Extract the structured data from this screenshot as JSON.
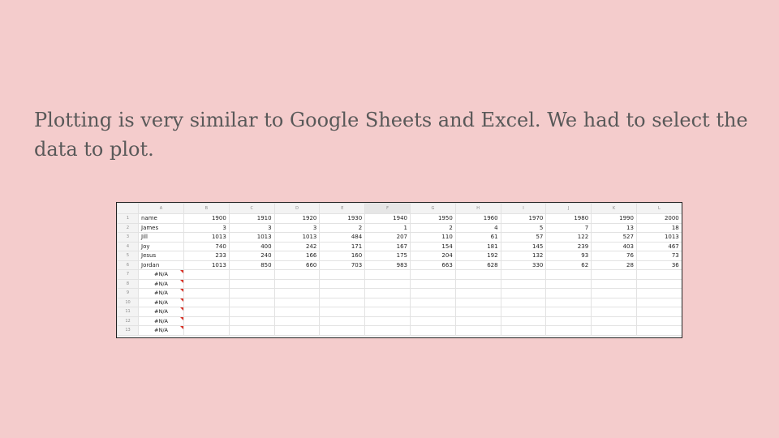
{
  "slide": {
    "text": "Plotting is very similar to Google Sheets and Excel. We had to select the data to plot."
  },
  "sheet": {
    "columns": [
      "A",
      "B",
      "C",
      "D",
      "E",
      "F",
      "G",
      "H",
      "I",
      "J",
      "K",
      "L"
    ],
    "selected_column": "F",
    "rows": [
      {
        "n": "1",
        "a": "name",
        "vals": [
          "1900",
          "1910",
          "1920",
          "1930",
          "1940",
          "1950",
          "1960",
          "1970",
          "1980",
          "1990",
          "2000"
        ]
      },
      {
        "n": "2",
        "a": "James",
        "vals": [
          "3",
          "3",
          "3",
          "2",
          "1",
          "2",
          "4",
          "5",
          "7",
          "13",
          "18"
        ]
      },
      {
        "n": "3",
        "a": "Jill",
        "vals": [
          "1013",
          "1013",
          "1013",
          "484",
          "207",
          "110",
          "61",
          "57",
          "122",
          "527",
          "1013"
        ]
      },
      {
        "n": "4",
        "a": "Joy",
        "vals": [
          "740",
          "400",
          "242",
          "171",
          "167",
          "154",
          "181",
          "145",
          "239",
          "403",
          "467"
        ]
      },
      {
        "n": "5",
        "a": "Jesus",
        "vals": [
          "233",
          "240",
          "166",
          "160",
          "175",
          "204",
          "192",
          "132",
          "93",
          "76",
          "73"
        ]
      },
      {
        "n": "6",
        "a": "Jordan",
        "vals": [
          "1013",
          "850",
          "660",
          "703",
          "983",
          "663",
          "628",
          "330",
          "62",
          "28",
          "36"
        ]
      }
    ],
    "na_rows": [
      {
        "n": "7",
        "a": "#N/A"
      },
      {
        "n": "8",
        "a": "#N/A"
      },
      {
        "n": "9",
        "a": "#N/A"
      },
      {
        "n": "10",
        "a": "#N/A"
      },
      {
        "n": "11",
        "a": "#N/A"
      },
      {
        "n": "12",
        "a": "#N/A"
      },
      {
        "n": "13",
        "a": "#N/A"
      }
    ]
  }
}
